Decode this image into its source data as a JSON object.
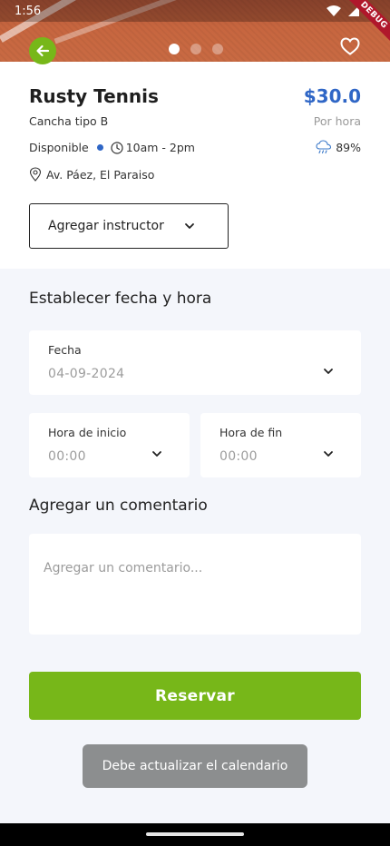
{
  "status": {
    "time": "1:56",
    "debug_label": "DEBUG"
  },
  "hero": {
    "slides": 3,
    "active_slide": 0
  },
  "court": {
    "name": "Rusty Tennis",
    "price": "$30.0",
    "price_unit": "Por hora",
    "type": "Cancha tipo B",
    "availability": "Disponible",
    "hours": "10am - 2pm",
    "rain_probability": "89%",
    "address": "Av. Páez, El Paraiso"
  },
  "instructor": {
    "label": "Agregar instructor"
  },
  "schedule": {
    "title": "Establecer fecha y hora",
    "date": {
      "label": "Fecha",
      "value": "04-09-2024"
    },
    "start": {
      "label": "Hora de inicio",
      "value": "00:00"
    },
    "end": {
      "label": "Hora de fin",
      "value": "00:00"
    }
  },
  "comment": {
    "title": "Agregar un comentario",
    "placeholder": "Agregar un comentario..."
  },
  "actions": {
    "reserve_label": "Reservar"
  },
  "toast": {
    "message": "Debe actualizar el calendario"
  },
  "colors": {
    "accent_green": "#77b719",
    "price_blue": "#2f66c6",
    "toast_gray": "#8c8e8f"
  }
}
